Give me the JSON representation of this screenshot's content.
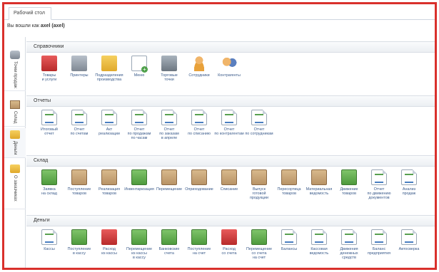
{
  "tab": {
    "label": "Рабочий стол"
  },
  "user": {
    "prefix": "Вы вошли как",
    "name": "axel (axel)"
  },
  "side": [
    {
      "label": "Точки продаж",
      "icon": "store-icon"
    },
    {
      "label": "Склад",
      "icon": "box-icon"
    },
    {
      "label": "Деньги",
      "icon": "money-icon"
    },
    {
      "label": "О заказчиках",
      "icon": "folder-icon"
    }
  ],
  "sections": {
    "refs": {
      "title": "Справочники",
      "items": [
        {
          "label": "Товары\nи услуги",
          "icon": "cart-icon"
        },
        {
          "label": "Принтеры",
          "icon": "printer-icon"
        },
        {
          "label": "Подразделения\nпроизводства",
          "icon": "printer-folder-icon"
        },
        {
          "label": "Меню",
          "icon": "menu-icon"
        },
        {
          "label": "Торговые\nточки",
          "icon": "cash-register-icon"
        },
        {
          "label": "Сотрудники",
          "icon": "employee-icon"
        },
        {
          "label": "Контрагенты",
          "icon": "contractors-icon"
        }
      ]
    },
    "reports": {
      "title": "Отчеты",
      "items": [
        {
          "label": "Итоговый\nотчет",
          "icon": "report-icon"
        },
        {
          "label": "Отчет\nпо счетам",
          "icon": "report-icon"
        },
        {
          "label": "Акт\nреализации",
          "icon": "report-icon"
        },
        {
          "label": "Отчет\nпо продажам\nпо часам",
          "icon": "report-icon"
        },
        {
          "label": "Отчет\nпо заказам\nв апреле",
          "icon": "report-icon"
        },
        {
          "label": "Отчет\nпо списанию",
          "icon": "report-icon"
        },
        {
          "label": "Отчет\nпо контрагентам",
          "icon": "report-icon"
        },
        {
          "label": "Отчет\nпо сотрудникам",
          "icon": "staff-report-icon"
        }
      ]
    },
    "warehouse": {
      "title": "Склад",
      "items": [
        {
          "label": "Заявка\nна склад",
          "icon": "request-icon"
        },
        {
          "label": "Поступление\nтоваров",
          "icon": "box-icon"
        },
        {
          "label": "Реализация\nтоваров",
          "icon": "box-icon"
        },
        {
          "label": "Инвентаризация",
          "icon": "inventory-icon"
        },
        {
          "label": "Перемещение",
          "icon": "box-move-icon"
        },
        {
          "label": "Оприходование",
          "icon": "box-in-icon"
        },
        {
          "label": "Списание",
          "icon": "box-out-icon"
        },
        {
          "label": "Выпуск\nготовой\nпродукции",
          "icon": "production-icon"
        },
        {
          "label": "Пересортица\nтоваров",
          "icon": "resort-icon"
        },
        {
          "label": "Материальная\nведомость",
          "icon": "sheet-icon"
        },
        {
          "label": "Движение\nтоваров",
          "icon": "movement-icon"
        },
        {
          "label": "Отчет\nпо движению\nдокументов",
          "icon": "report-icon"
        },
        {
          "label": "Анализ\nпродаж",
          "icon": "report-icon"
        }
      ]
    },
    "money": {
      "title": "Деньги",
      "items": [
        {
          "label": "Кассы",
          "icon": "cash-icon"
        },
        {
          "label": "Поступление\nв кассу",
          "icon": "cash-in-icon"
        },
        {
          "label": "Расход\nиз кассы",
          "icon": "cash-out-icon"
        },
        {
          "label": "Перемещение\nиз кассы\nв кассу",
          "icon": "cash-move-icon"
        },
        {
          "label": "Банковские\nсчета",
          "icon": "bank-icon"
        },
        {
          "label": "Поступление\nна счет",
          "icon": "bank-in-icon"
        },
        {
          "label": "Расход\nсо счета",
          "icon": "bank-out-icon"
        },
        {
          "label": "Перемещение\nсо счета\nна счет",
          "icon": "bank-move-icon"
        },
        {
          "label": "Балансы",
          "icon": "report-icon"
        },
        {
          "label": "Кассовая\nведомость",
          "icon": "report-icon"
        },
        {
          "label": "Движения\nденежных\nсредств",
          "icon": "report-icon"
        },
        {
          "label": "Баланс\nпредприятия",
          "icon": "report-icon"
        },
        {
          "label": "Автосверка",
          "icon": "report-icon"
        }
      ]
    }
  }
}
